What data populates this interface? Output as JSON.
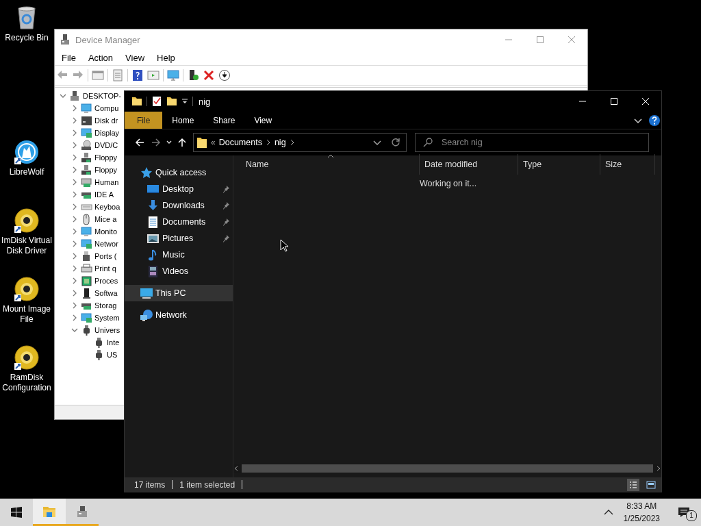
{
  "desktop_icons": [
    {
      "label": "Recycle Bin",
      "kind": "recycle"
    },
    {
      "label": "LibreWolf",
      "kind": "wolf"
    },
    {
      "label": "ImDisk Virtual Disk Driver",
      "kind": "disc"
    },
    {
      "label": "Mount Image File",
      "kind": "disc"
    },
    {
      "label": "RamDisk Configuration",
      "kind": "disc"
    }
  ],
  "device_manager": {
    "title": "Device Manager",
    "menu": [
      "File",
      "Action",
      "View",
      "Help"
    ],
    "tree": {
      "label": "DESKTOP-",
      "kind": "pc",
      "expanded": true,
      "children": [
        {
          "label": "Compu",
          "kind": "monitor",
          "expanded": false
        },
        {
          "label": "Disk dr",
          "kind": "disk",
          "expanded": false
        },
        {
          "label": "Display",
          "kind": "display",
          "expanded": false
        },
        {
          "label": "DVD/C",
          "kind": "dvd",
          "expanded": false
        },
        {
          "label": "Floppy",
          "kind": "floppy",
          "expanded": false
        },
        {
          "label": "Floppy",
          "kind": "floppy",
          "expanded": false
        },
        {
          "label": "Human",
          "kind": "hid",
          "expanded": false
        },
        {
          "label": "IDE A",
          "kind": "card",
          "expanded": false
        },
        {
          "label": "Keyboa",
          "kind": "keyboard",
          "expanded": false
        },
        {
          "label": "Mice a",
          "kind": "mouse",
          "expanded": false
        },
        {
          "label": "Monito",
          "kind": "monitor",
          "expanded": false
        },
        {
          "label": "Networ",
          "kind": "display",
          "expanded": false
        },
        {
          "label": "Ports (",
          "kind": "port",
          "expanded": false
        },
        {
          "label": "Print q",
          "kind": "printer",
          "expanded": false
        },
        {
          "label": "Proces",
          "kind": "chip",
          "expanded": false
        },
        {
          "label": "Softwa",
          "kind": "tower",
          "expanded": false
        },
        {
          "label": "Storag",
          "kind": "card",
          "expanded": false
        },
        {
          "label": "System",
          "kind": "display",
          "expanded": false
        },
        {
          "label": "Univers",
          "kind": "usb",
          "expanded": true,
          "children": [
            {
              "label": "Inte",
              "kind": "usb"
            },
            {
              "label": "US",
              "kind": "usb"
            }
          ]
        }
      ]
    }
  },
  "explorer": {
    "title": "nig",
    "ribbon_tabs": [
      {
        "label": "File",
        "selected": true
      },
      {
        "label": "Home",
        "selected": false
      },
      {
        "label": "Share",
        "selected": false
      },
      {
        "label": "View",
        "selected": false
      }
    ],
    "address": {
      "overflow": "«",
      "segments": [
        "Documents",
        "nig"
      ]
    },
    "search": {
      "placeholder": "Search nig"
    },
    "nav": [
      {
        "label": "Quick access",
        "kind": "star",
        "selected": false,
        "children": [
          {
            "label": "Desktop",
            "kind": "desktop",
            "pinned": true
          },
          {
            "label": "Downloads",
            "kind": "downloads",
            "pinned": true
          },
          {
            "label": "Documents",
            "kind": "documents",
            "pinned": true
          },
          {
            "label": "Pictures",
            "kind": "pictures",
            "pinned": true
          },
          {
            "label": "Music",
            "kind": "music",
            "pinned": false
          },
          {
            "label": "Videos",
            "kind": "videos",
            "pinned": false
          }
        ]
      },
      {
        "label": "This PC",
        "kind": "pc",
        "selected": true
      },
      {
        "label": "Network",
        "kind": "network",
        "selected": false
      }
    ],
    "columns": [
      {
        "label": "Name",
        "sorted": true
      },
      {
        "label": "Date modified",
        "sorted": false
      },
      {
        "label": "Type",
        "sorted": false
      },
      {
        "label": "Size",
        "sorted": false
      }
    ],
    "message": "Working on it...",
    "status": [
      "17 items",
      "1 item selected"
    ]
  },
  "taskbar": {
    "apps": [
      {
        "kind": "explorer",
        "active": true
      },
      {
        "kind": "devmgr",
        "active": false
      }
    ],
    "time": "8:33 AM",
    "date": "1/25/2023",
    "notifications": "1"
  }
}
